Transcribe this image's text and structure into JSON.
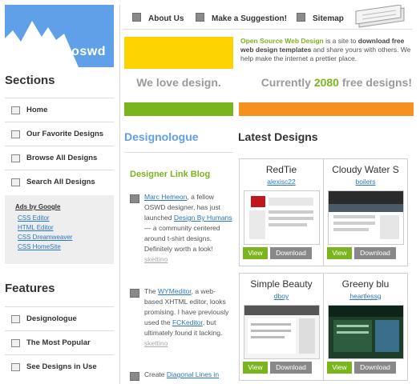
{
  "logo": {
    "text": "oswd"
  },
  "topnav": [
    {
      "label": "About Us"
    },
    {
      "label": "Make a Suggestion!"
    },
    {
      "label": "Sitemap"
    }
  ],
  "intro": {
    "strong1": "Open Source Web Design",
    "text1": " is a site to ",
    "strong2": "download free web design templates",
    "text2": " and share yours with others. We help make the internet a prettier place."
  },
  "taglines": {
    "left": "We love design.",
    "right_prefix": "Currently ",
    "right_count": "2080",
    "right_suffix": " free designs!"
  },
  "sidebar": {
    "sections_title": "Sections",
    "sections": [
      {
        "label": "Home",
        "icon": "house-icon"
      },
      {
        "label": "Our Favorite Designs",
        "icon": "heart-icon"
      },
      {
        "label": "Browse All Designs",
        "icon": "grid-icon"
      },
      {
        "label": "Search All Designs",
        "icon": "search-icon"
      }
    ],
    "ads": {
      "title": "Ads by Google",
      "links": [
        "CSS Editor",
        "HTML Editor",
        "CSS Dreamweaver",
        "CSS HomeSite"
      ]
    },
    "features_title": "Features",
    "features": [
      {
        "label": "Designologue",
        "icon": "pencil-icon"
      },
      {
        "label": "The Most Popular",
        "icon": "chart-icon"
      },
      {
        "label": "See Designs in Use",
        "icon": "eye-icon"
      }
    ]
  },
  "designologue": {
    "title": "Designologue",
    "blog_title": "Designer Link Blog",
    "entries": [
      {
        "link1": "Marc Hemeon",
        "text1": ", a fellow OSWD designer, has just launched ",
        "link2": "Design By Humans",
        "text2": " — a community centered around t-shirt designs. Definitely worth a look! ",
        "skettino": "skettino"
      },
      {
        "text0": "The ",
        "link1": "WYMeditor",
        "text1": ", a web-based XHTML editor, looks promising. I have previously used the ",
        "link2": "FCKeditor",
        "text2": ", but ultimately found it lacking. ",
        "skettino": "skettino"
      },
      {
        "text0": "Create ",
        "link1": "Diagonal Lines in"
      }
    ]
  },
  "latest": {
    "title": "Latest Designs",
    "cards": [
      {
        "name": "RedTie",
        "author": "alexisc22",
        "view": "View",
        "download": "Download"
      },
      {
        "name": "Cloudy Water S",
        "author": "boilers",
        "view": "View",
        "download": "Download"
      },
      {
        "name": "Simple Beauty",
        "author": "dboy",
        "view": "View",
        "download": "Download"
      },
      {
        "name": "Greeny blu",
        "author": "heartlessg",
        "view": "View",
        "download": "Download"
      }
    ]
  },
  "colors": {
    "logo_blue": "#5fa0e8",
    "yellow": "#fdd400",
    "green": "#7ab51d",
    "orange": "#f6901e",
    "link": "#2a76c6"
  }
}
